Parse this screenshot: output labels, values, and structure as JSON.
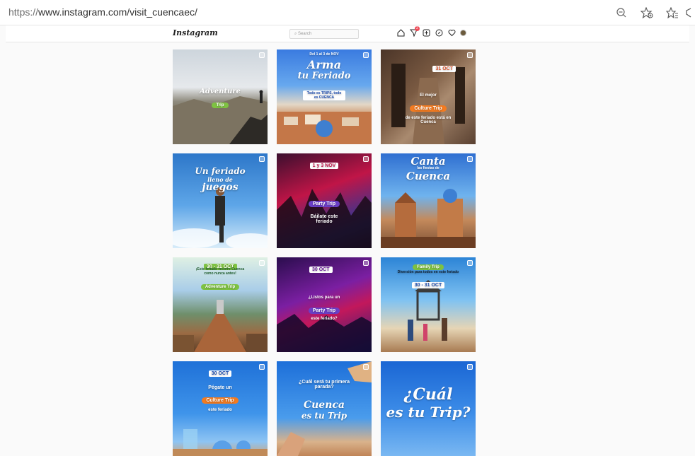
{
  "browser": {
    "url_prefix": "https://",
    "url_main": "www.instagram.com/visit_cuencaec/"
  },
  "header": {
    "logo": "Instagram",
    "search_placeholder": "Search",
    "notification_count": "2"
  },
  "posts": [
    {
      "lines": [
        "Adventure",
        "Trip"
      ]
    },
    {
      "top": "Del 1 al 3 de NOV",
      "title": [
        "Arma",
        "tu Feriado"
      ],
      "sub": "Todo es TRIPS, todo es CUENCA"
    },
    {
      "date": "31 OCT",
      "mid": "El mejor",
      "pill": "Culture Trip",
      "sub": "de este feriado está en Cuenca"
    },
    {
      "title": [
        "Un feriado",
        "lleno de",
        "juegos"
      ]
    },
    {
      "date": "1 y 3 NOV",
      "pill": "Party Trip",
      "sub": "Báilate este feriado"
    },
    {
      "title": [
        "Canta",
        "las fiestas de",
        "Cuenca"
      ]
    },
    {
      "date": "30 - 31 OCT",
      "sub": "¡Este feriado recorre Cuenca como nunca antes!",
      "pill": "Adventure Trip"
    },
    {
      "date": "30 OCT",
      "mid": "¿Listos para un",
      "pill": "Party Trip",
      "sub": "este feriado?"
    },
    {
      "top": "Family Trip",
      "sub": "Diversión para todos en este feriado",
      "date": "30 - 31 OCT"
    },
    {
      "date": "30 OCT",
      "mid": "Pégate un",
      "pill": "Culture Trip",
      "sub": "este feriado"
    },
    {
      "top": "¿Cuál será tu primera parada?",
      "title": [
        "Cuenca",
        "es tu Trip"
      ]
    },
    {
      "title": [
        "¿Cuál",
        "es tu Trip?"
      ]
    }
  ]
}
